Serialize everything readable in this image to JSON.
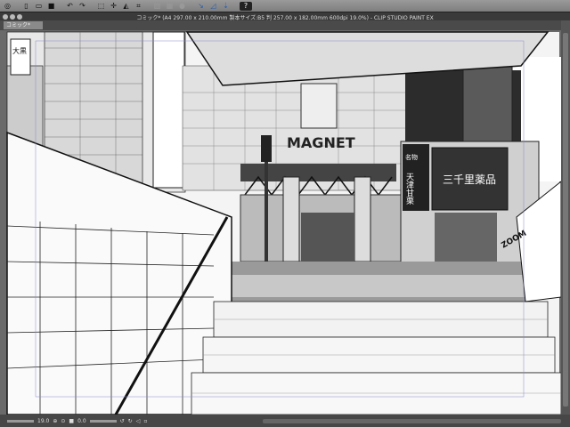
{
  "toolbar": {
    "icons": [
      "clip-studio-menu-icon",
      "new-icon",
      "open-icon",
      "save-icon",
      "undo-icon",
      "redo-icon",
      "selection-icon",
      "transform-icon",
      "fill-icon",
      "crop-icon",
      "snap-ruler-icon",
      "snap-grid-icon",
      "snap-point-icon",
      "help-icon"
    ]
  },
  "window": {
    "title": "コミック* (A4 297.00 x 210.00mm 製本サイズ:B5 判 257.00 x 182.00mm 600dpi 19.0%)  - CLIP STUDIO PAINT EX"
  },
  "tabs": [
    {
      "label": "コミック*"
    }
  ],
  "canvas": {
    "signs": {
      "magnet": "MAGNET",
      "shop": "三千里薬品",
      "tenshin": "天津甘栗",
      "meibutsu": "名物",
      "zoom": "ZOOM",
      "left": "大黒"
    }
  },
  "status": {
    "zoom": "19.0",
    "angle": "0.0"
  }
}
